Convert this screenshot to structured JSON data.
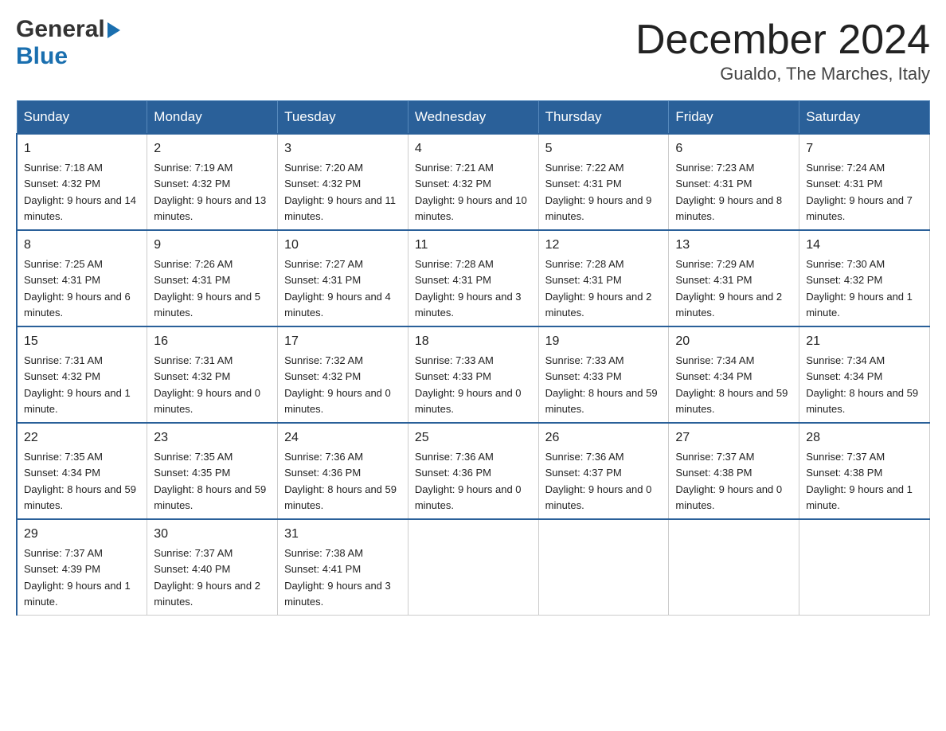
{
  "header": {
    "logo_general": "General",
    "logo_blue": "Blue",
    "month_title": "December 2024",
    "location": "Gualdo, The Marches, Italy"
  },
  "days_of_week": [
    "Sunday",
    "Monday",
    "Tuesday",
    "Wednesday",
    "Thursday",
    "Friday",
    "Saturday"
  ],
  "weeks": [
    [
      {
        "day": "1",
        "sunrise": "7:18 AM",
        "sunset": "4:32 PM",
        "daylight": "9 hours and 14 minutes."
      },
      {
        "day": "2",
        "sunrise": "7:19 AM",
        "sunset": "4:32 PM",
        "daylight": "9 hours and 13 minutes."
      },
      {
        "day": "3",
        "sunrise": "7:20 AM",
        "sunset": "4:32 PM",
        "daylight": "9 hours and 11 minutes."
      },
      {
        "day": "4",
        "sunrise": "7:21 AM",
        "sunset": "4:32 PM",
        "daylight": "9 hours and 10 minutes."
      },
      {
        "day": "5",
        "sunrise": "7:22 AM",
        "sunset": "4:31 PM",
        "daylight": "9 hours and 9 minutes."
      },
      {
        "day": "6",
        "sunrise": "7:23 AM",
        "sunset": "4:31 PM",
        "daylight": "9 hours and 8 minutes."
      },
      {
        "day": "7",
        "sunrise": "7:24 AM",
        "sunset": "4:31 PM",
        "daylight": "9 hours and 7 minutes."
      }
    ],
    [
      {
        "day": "8",
        "sunrise": "7:25 AM",
        "sunset": "4:31 PM",
        "daylight": "9 hours and 6 minutes."
      },
      {
        "day": "9",
        "sunrise": "7:26 AM",
        "sunset": "4:31 PM",
        "daylight": "9 hours and 5 minutes."
      },
      {
        "day": "10",
        "sunrise": "7:27 AM",
        "sunset": "4:31 PM",
        "daylight": "9 hours and 4 minutes."
      },
      {
        "day": "11",
        "sunrise": "7:28 AM",
        "sunset": "4:31 PM",
        "daylight": "9 hours and 3 minutes."
      },
      {
        "day": "12",
        "sunrise": "7:28 AM",
        "sunset": "4:31 PM",
        "daylight": "9 hours and 2 minutes."
      },
      {
        "day": "13",
        "sunrise": "7:29 AM",
        "sunset": "4:31 PM",
        "daylight": "9 hours and 2 minutes."
      },
      {
        "day": "14",
        "sunrise": "7:30 AM",
        "sunset": "4:32 PM",
        "daylight": "9 hours and 1 minute."
      }
    ],
    [
      {
        "day": "15",
        "sunrise": "7:31 AM",
        "sunset": "4:32 PM",
        "daylight": "9 hours and 1 minute."
      },
      {
        "day": "16",
        "sunrise": "7:31 AM",
        "sunset": "4:32 PM",
        "daylight": "9 hours and 0 minutes."
      },
      {
        "day": "17",
        "sunrise": "7:32 AM",
        "sunset": "4:32 PM",
        "daylight": "9 hours and 0 minutes."
      },
      {
        "day": "18",
        "sunrise": "7:33 AM",
        "sunset": "4:33 PM",
        "daylight": "9 hours and 0 minutes."
      },
      {
        "day": "19",
        "sunrise": "7:33 AM",
        "sunset": "4:33 PM",
        "daylight": "8 hours and 59 minutes."
      },
      {
        "day": "20",
        "sunrise": "7:34 AM",
        "sunset": "4:34 PM",
        "daylight": "8 hours and 59 minutes."
      },
      {
        "day": "21",
        "sunrise": "7:34 AM",
        "sunset": "4:34 PM",
        "daylight": "8 hours and 59 minutes."
      }
    ],
    [
      {
        "day": "22",
        "sunrise": "7:35 AM",
        "sunset": "4:34 PM",
        "daylight": "8 hours and 59 minutes."
      },
      {
        "day": "23",
        "sunrise": "7:35 AM",
        "sunset": "4:35 PM",
        "daylight": "8 hours and 59 minutes."
      },
      {
        "day": "24",
        "sunrise": "7:36 AM",
        "sunset": "4:36 PM",
        "daylight": "8 hours and 59 minutes."
      },
      {
        "day": "25",
        "sunrise": "7:36 AM",
        "sunset": "4:36 PM",
        "daylight": "9 hours and 0 minutes."
      },
      {
        "day": "26",
        "sunrise": "7:36 AM",
        "sunset": "4:37 PM",
        "daylight": "9 hours and 0 minutes."
      },
      {
        "day": "27",
        "sunrise": "7:37 AM",
        "sunset": "4:38 PM",
        "daylight": "9 hours and 0 minutes."
      },
      {
        "day": "28",
        "sunrise": "7:37 AM",
        "sunset": "4:38 PM",
        "daylight": "9 hours and 1 minute."
      }
    ],
    [
      {
        "day": "29",
        "sunrise": "7:37 AM",
        "sunset": "4:39 PM",
        "daylight": "9 hours and 1 minute."
      },
      {
        "day": "30",
        "sunrise": "7:37 AM",
        "sunset": "4:40 PM",
        "daylight": "9 hours and 2 minutes."
      },
      {
        "day": "31",
        "sunrise": "7:38 AM",
        "sunset": "4:41 PM",
        "daylight": "9 hours and 3 minutes."
      },
      null,
      null,
      null,
      null
    ]
  ],
  "labels": {
    "sunrise": "Sunrise:",
    "sunset": "Sunset:",
    "daylight": "Daylight:"
  }
}
